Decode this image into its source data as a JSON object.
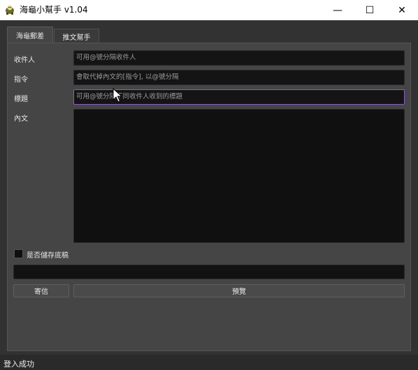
{
  "window": {
    "title": "海龜小幫手 v1.04",
    "icon": "turtle-icon",
    "controls": {
      "minimize": "—",
      "maximize": "☐",
      "close": "✕"
    }
  },
  "tabs": [
    {
      "label": "海龜郵差",
      "active": true
    },
    {
      "label": "推文幫手",
      "active": false
    }
  ],
  "form": {
    "recipients": {
      "label": "收件人",
      "placeholder": "可用@號分隔收件人"
    },
    "command": {
      "label": "指令",
      "placeholder": "會取代掉內文的[指令], 以@號分隔"
    },
    "subject": {
      "label": "標題",
      "placeholder": "可用@號分隔不同收件人收到的標題"
    },
    "body": {
      "label": "內文",
      "value": ""
    },
    "save_draft": {
      "label": "是否儲存底稿",
      "checked": false
    },
    "status_value": ""
  },
  "buttons": {
    "send": "寄信",
    "preview": "預覽"
  },
  "statusbar": {
    "text": "登入成功"
  },
  "colors": {
    "focus_border": "#8a5cc2",
    "background": "#323232",
    "panel": "#454545"
  }
}
